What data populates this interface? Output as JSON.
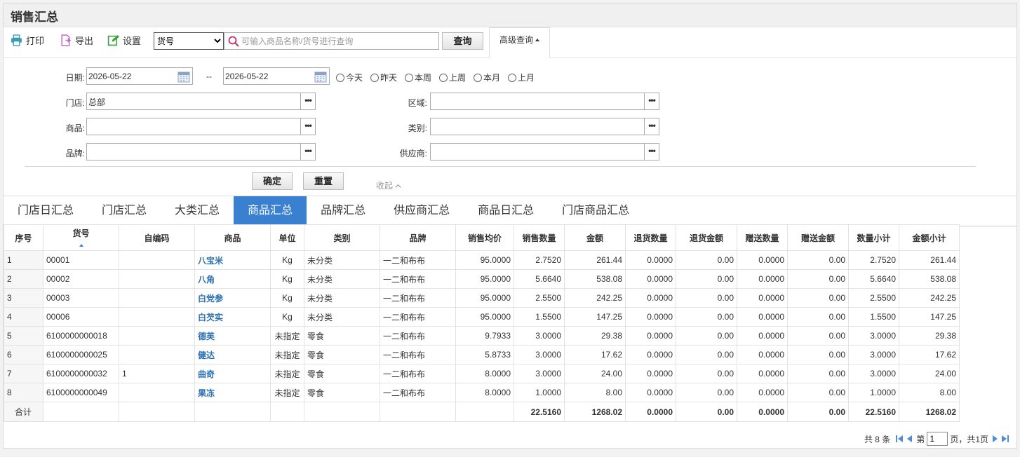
{
  "page": {
    "title": "销售汇总"
  },
  "toolbar": {
    "print_label": "打印",
    "export_label": "导出",
    "settings_label": "设置",
    "field_select": {
      "selected": "货号"
    },
    "search_placeholder": "可输入商品名称/货号进行查询",
    "query_label": "查询",
    "advanced_label": "高级查询"
  },
  "filter": {
    "date_label": "日期:",
    "date_from": "2026-05-22",
    "date_sep": "--",
    "date_to": "2026-05-22",
    "quick_dates": [
      "今天",
      "昨天",
      "本周",
      "上周",
      "本月",
      "上月"
    ],
    "store_label": "门店:",
    "store_value": "总部",
    "region_label": "区域:",
    "product_label": "商品:",
    "category_label": "类别:",
    "brand_label": "品牌:",
    "supplier_label": "供应商:",
    "ellipsis": "•••",
    "confirm_label": "确定",
    "reset_label": "重置",
    "collapse_label": "收起"
  },
  "tabs": [
    "门店日汇总",
    "门店汇总",
    "大类汇总",
    "商品汇总",
    "品牌汇总",
    "供应商汇总",
    "商品日汇总",
    "门店商品汇总"
  ],
  "active_tab": 3,
  "table": {
    "columns": [
      "序号",
      "货号",
      "自编码",
      "商品",
      "单位",
      "类别",
      "品牌",
      "销售均价",
      "销售数量",
      "金额",
      "退货数量",
      "退货金额",
      "赠送数量",
      "赠送金额",
      "数量小计",
      "金额小计"
    ],
    "rows": [
      [
        "1",
        "00001",
        "",
        "八宝米",
        "Kg",
        "未分类",
        "一二和布布",
        "95.0000",
        "2.7520",
        "261.44",
        "0.0000",
        "0.00",
        "0.0000",
        "0.00",
        "2.7520",
        "261.44"
      ],
      [
        "2",
        "00002",
        "",
        "八角",
        "Kg",
        "未分类",
        "一二和布布",
        "95.0000",
        "5.6640",
        "538.08",
        "0.0000",
        "0.00",
        "0.0000",
        "0.00",
        "5.6640",
        "538.08"
      ],
      [
        "3",
        "00003",
        "",
        "白党参",
        "Kg",
        "未分类",
        "一二和布布",
        "95.0000",
        "2.5500",
        "242.25",
        "0.0000",
        "0.00",
        "0.0000",
        "0.00",
        "2.5500",
        "242.25"
      ],
      [
        "4",
        "00006",
        "",
        "白芡实",
        "Kg",
        "未分类",
        "一二和布布",
        "95.0000",
        "1.5500",
        "147.25",
        "0.0000",
        "0.00",
        "0.0000",
        "0.00",
        "1.5500",
        "147.25"
      ],
      [
        "5",
        "6100000000018",
        "",
        "德芙",
        "未指定",
        "零食",
        "一二和布布",
        "9.7933",
        "3.0000",
        "29.38",
        "0.0000",
        "0.00",
        "0.0000",
        "0.00",
        "3.0000",
        "29.38"
      ],
      [
        "6",
        "6100000000025",
        "",
        "健达",
        "未指定",
        "零食",
        "一二和布布",
        "5.8733",
        "3.0000",
        "17.62",
        "0.0000",
        "0.00",
        "0.0000",
        "0.00",
        "3.0000",
        "17.62"
      ],
      [
        "7",
        "6100000000032",
        "1",
        "曲奇",
        "未指定",
        "零食",
        "一二和布布",
        "8.0000",
        "3.0000",
        "24.00",
        "0.0000",
        "0.00",
        "0.0000",
        "0.00",
        "3.0000",
        "24.00"
      ],
      [
        "8",
        "6100000000049",
        "",
        "果冻",
        "未指定",
        "零食",
        "一二和布布",
        "8.0000",
        "1.0000",
        "8.00",
        "0.0000",
        "0.00",
        "0.0000",
        "0.00",
        "1.0000",
        "8.00"
      ]
    ],
    "total_row": [
      "合计",
      "",
      "",
      "",
      "",
      "",
      "",
      "",
      "22.5160",
      "1268.02",
      "0.0000",
      "0.00",
      "0.0000",
      "0.00",
      "22.5160",
      "1268.02"
    ]
  },
  "pager": {
    "total_text": "共 8 条",
    "page_prefix": "第",
    "current_page": "1",
    "page_suffix": "页，共1页"
  },
  "colors": {
    "accent": "#3a80d1",
    "link": "#2a6fb0"
  }
}
